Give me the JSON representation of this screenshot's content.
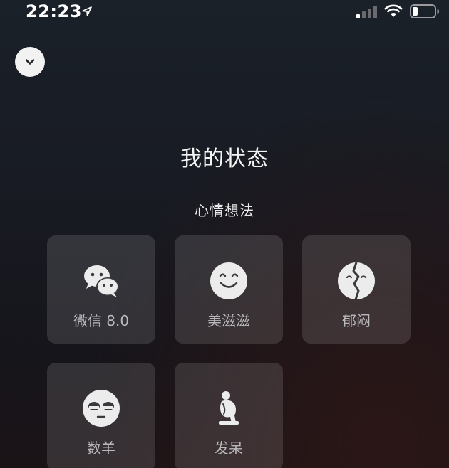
{
  "status_bar": {
    "time": "22:23",
    "icons": [
      "location-arrow-icon",
      "cellular-signal-icon",
      "wifi-icon",
      "battery-icon"
    ]
  },
  "header": {
    "collapse_icon": "chevron-down-icon"
  },
  "main": {
    "title": "我的状态",
    "section_title": "心情想法",
    "statuses": [
      {
        "label": "微信 8.0",
        "icon": "wechat-icon"
      },
      {
        "label": "美滋滋",
        "icon": "happy-face-icon"
      },
      {
        "label": "郁闷",
        "icon": "broken-heart-face-icon"
      },
      {
        "label": "数羊",
        "icon": "sleepy-face-icon"
      },
      {
        "label": "发呆",
        "icon": "thinker-icon"
      }
    ]
  },
  "colors": {
    "tile_background": "#3a3a3e",
    "tile_label": "#b9b9bd",
    "icon_fill": "#ececec",
    "collapse_button": "#f2f2f2"
  }
}
